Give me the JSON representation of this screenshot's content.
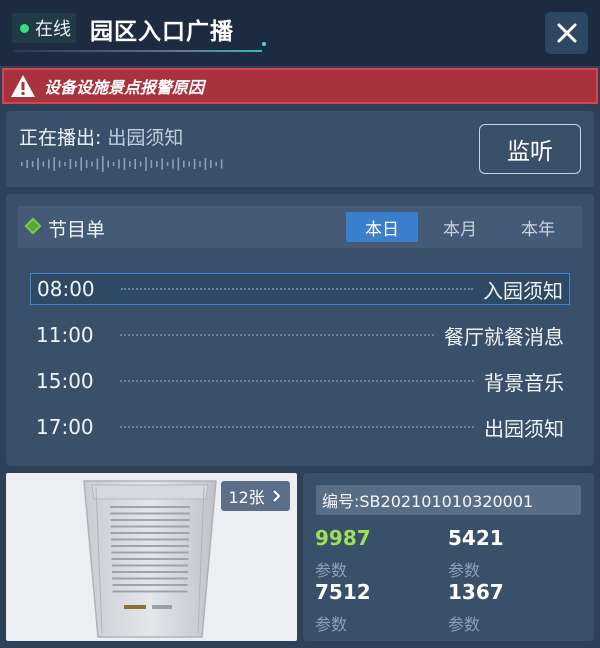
{
  "header": {
    "status": "在线",
    "title": "园区入口广播"
  },
  "alert": {
    "text": "设备设施景点报警原因"
  },
  "now_playing": {
    "label": "正在播出:",
    "value": "出园须知",
    "listen_button": "监听"
  },
  "program": {
    "title": "节目单",
    "tabs": [
      {
        "label": "本日",
        "active": true
      },
      {
        "label": "本月",
        "active": false
      },
      {
        "label": "本年",
        "active": false
      }
    ],
    "rows": [
      {
        "time": "08:00",
        "name": "入园须知",
        "selected": true
      },
      {
        "time": "11:00",
        "name": "餐厅就餐消息",
        "selected": false
      },
      {
        "time": "15:00",
        "name": "背景音乐",
        "selected": false
      },
      {
        "time": "17:00",
        "name": "出园须知",
        "selected": false
      }
    ]
  },
  "photo": {
    "count_label": "12张"
  },
  "device": {
    "id": "编号:SB202101010320001",
    "stats": [
      {
        "value": "9987",
        "label": "参数",
        "highlight": true
      },
      {
        "value": "5421",
        "label": "参数",
        "highlight": false
      },
      {
        "value": "7512",
        "label": "参数",
        "highlight": false
      },
      {
        "value": "1367",
        "label": "参数",
        "highlight": false
      }
    ]
  },
  "colors": {
    "background": "#2f4159",
    "header": "#1c2b40",
    "alert": "#a8323e",
    "accent_blue": "#3a7fcc",
    "online_green": "#37e07a",
    "highlight_green": "#9ee05a"
  },
  "icons": [
    "status-dot-icon",
    "close-icon",
    "warning-icon",
    "waveform-icon",
    "diamond-icon",
    "chevron-right-icon"
  ]
}
